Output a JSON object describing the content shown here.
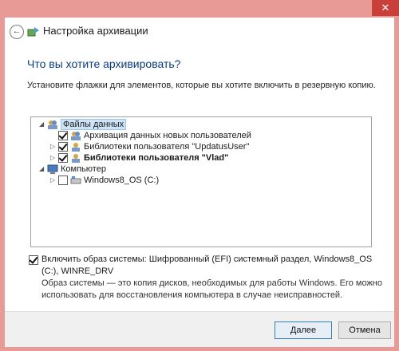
{
  "window": {
    "title": "Настройка архивации",
    "close_glyph": "✕"
  },
  "page": {
    "heading": "Что вы хотите архивировать?",
    "instruction": "Установите флажки для элементов, которые вы хотите включить в резервную копию."
  },
  "tree": {
    "items": [
      {
        "label": "Файлы данных",
        "expanded": true,
        "checked": null,
        "bold": false,
        "icon": "users-icon"
      },
      {
        "label": "Архивация данных новых пользователей",
        "expanded": null,
        "checked": true,
        "bold": false,
        "icon": "users-icon"
      },
      {
        "label": "Библиотеки пользователя \"UpdatusUser\"",
        "expanded": false,
        "checked": true,
        "bold": false,
        "icon": "user-icon"
      },
      {
        "label": "Библиотеки пользователя \"Vlad\"",
        "expanded": false,
        "checked": true,
        "bold": true,
        "icon": "user-icon"
      },
      {
        "label": "Компьютер",
        "expanded": true,
        "checked": null,
        "bold": false,
        "icon": "computer-icon"
      },
      {
        "label": "Windows8_OS (C:)",
        "expanded": false,
        "checked": false,
        "bold": false,
        "icon": "drive-icon"
      }
    ]
  },
  "system_image": {
    "checked": true,
    "label": "Включить образ системы: Шифрованный (EFI) системный раздел, Windows8_OS (C:), WINRE_DRV",
    "description": "Образ системы — это копия дисков, необходимых для работы Windows. Его можно использовать для восстановления компьютера в случае неисправностей."
  },
  "buttons": {
    "next": "Далее",
    "cancel": "Отмена"
  }
}
